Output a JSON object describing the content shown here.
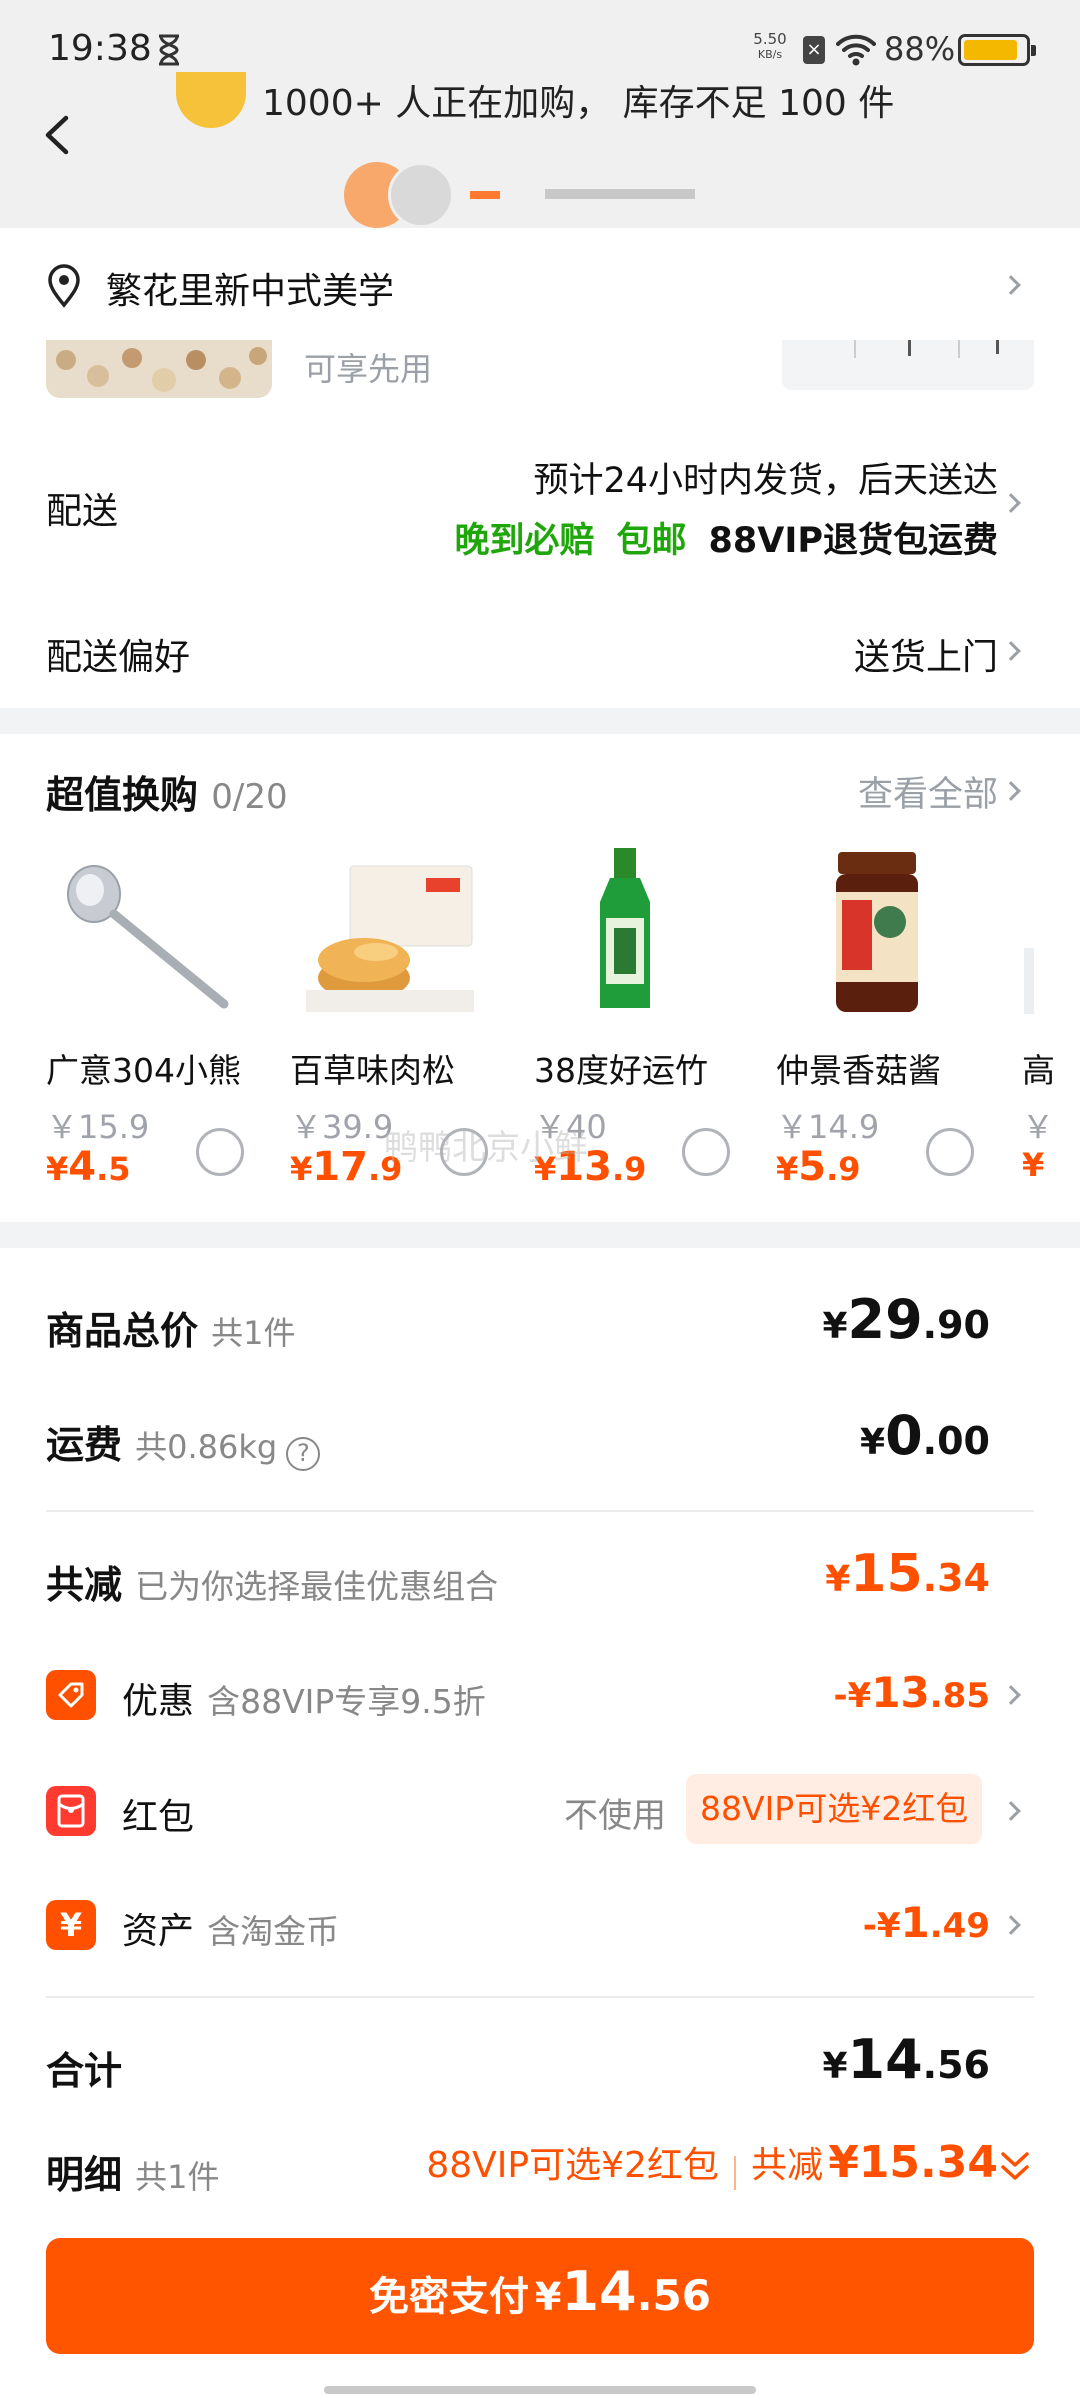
{
  "status_bar": {
    "time": "19:38",
    "net_speed_top": "5.50",
    "net_speed_bottom": "KB/s",
    "battery": "88%"
  },
  "header": {
    "banner_text": "1000+ 人正在加购， 库存不足 100 件"
  },
  "address": {
    "text": "繁花里新中式美学"
  },
  "product_snippet": {
    "note": "可享先用"
  },
  "delivery": {
    "label": "配送",
    "line1": "预计24小时内发货，后天送达",
    "tag1": "晚到必赔",
    "tag2": "包邮",
    "tag3": "88VIP退货包运费"
  },
  "preference": {
    "label": "配送偏好",
    "value": "送货上门"
  },
  "exchange": {
    "title": "超值换购",
    "count": "0/20",
    "view_all": "查看全部",
    "items": [
      {
        "name": "广意304小熊",
        "orig": "￥15.9",
        "sym": "¥",
        "int": "4",
        "dec": ".5"
      },
      {
        "name": "百草味肉松",
        "orig": "￥39.9",
        "sym": "¥",
        "int": "17",
        "dec": ".9"
      },
      {
        "name": "38度好运竹",
        "orig": "￥40",
        "sym": "¥",
        "int": "13",
        "dec": ".9"
      },
      {
        "name": "仲景香菇酱",
        "orig": "￥14.9",
        "sym": "¥",
        "int": "5",
        "dec": ".9"
      }
    ],
    "partial": {
      "name": "高",
      "orig": "￥",
      "sym": "¥"
    },
    "watermark": "鸭鸭北京小鲜"
  },
  "summary": {
    "goods_label": "商品总价",
    "goods_count": "共1件",
    "goods_sym": "¥",
    "goods_int": "29",
    "goods_dec": ".90",
    "ship_label": "运费",
    "ship_weight": "共0.86kg",
    "ship_help": "?",
    "ship_sym": "¥",
    "ship_int": "0",
    "ship_dec": ".00",
    "reduce_label": "共减",
    "reduce_note": "已为你选择最佳优惠组合",
    "reduce_sym": "¥",
    "reduce_int": "15",
    "reduce_dec": ".34",
    "discount_label": "优惠",
    "discount_note": "含88VIP专享9.5折",
    "discount_pre": "-¥",
    "discount_int": "13",
    "discount_dec": ".85",
    "redpack_label": "红包",
    "redpack_none": "不使用",
    "redpack_tag": "88VIP可选¥2红包",
    "asset_label": "资产",
    "asset_note": "含淘金币",
    "asset_icon": "¥",
    "asset_pre": "-¥",
    "asset_int": "1",
    "asset_dec": ".49",
    "total_label": "合计",
    "total_sym": "¥",
    "total_int": "14",
    "total_dec": ".56",
    "detail_label": "明细",
    "detail_count": "共1件",
    "detail_tag": "88VIP可选¥2红包",
    "detail_reduce_label": "共减",
    "detail_reduce_val": "¥15.34"
  },
  "pay": {
    "label": "免密支付",
    "sym": "¥",
    "int": "14",
    "dec": ".56"
  },
  "colors": {
    "orange": "#ff5000",
    "green": "#1ea60a"
  }
}
